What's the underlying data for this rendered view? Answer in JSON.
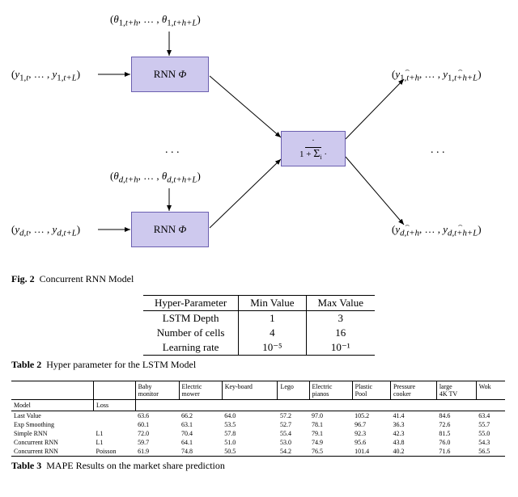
{
  "figure": {
    "theta_top": "(θ₁,ₜ₊ₕ, … , θ₁,ₜ₊ₕ₊L)",
    "theta_bot": "(θ_d,ₜ₊ₕ, … , θ_d,ₜ₊ₕ₊L)",
    "y_in_top": "(y₁,ₜ, … , y₁,ₜ₊L)",
    "y_in_bot": "(y_d,ₜ, … , y_d,ₜ₊L)",
    "rnn_label": "RNN Φ",
    "softmax_label": "· / (1 + Σᵢ ·)",
    "y_out_top": "(ŷ₁,ₜ₊ₕ, … , ŷ₁,ₜ₊ₕ₊L)",
    "y_out_bot": "(ŷ_d,ₜ₊ₕ, … , ŷ_d,ₜ₊ₕ₊L)",
    "dots": ". . .",
    "caption_num": "Fig. 2",
    "caption_text": "Concurrent RNN Model"
  },
  "hyper": {
    "caption_num": "Table 2",
    "caption_text": "Hyper parameter for the LSTM Model",
    "headers": [
      "Hyper-Parameter",
      "Min Value",
      "Max Value"
    ],
    "rows": [
      [
        "LSTM Depth",
        "1",
        "3"
      ],
      [
        "Number of cells",
        "4",
        "16"
      ],
      [
        "Learning rate",
        "10⁻⁵",
        "10⁻¹"
      ]
    ]
  },
  "mape": {
    "caption_num": "Table 3",
    "caption_text": "MAPE Results on the market share prediction",
    "col_model": "Model",
    "col_loss": "Loss",
    "columns": [
      "Baby monitor",
      "Electric mower",
      "Key-board",
      "Lego",
      "Electric pianos",
      "Plastic Pool",
      "Pressure cooker",
      "large 4K TV",
      "Wok"
    ],
    "rows": [
      {
        "model": "Last Value",
        "loss": "",
        "vals": [
          "63.6",
          "66.2",
          "64.0",
          "57.2",
          "97.0",
          "105.2",
          "41.4",
          "84.6",
          "63.4"
        ],
        "bold": []
      },
      {
        "model": "Exp Smoothing",
        "loss": "",
        "vals": [
          "60.1",
          "63.1",
          "53.5",
          "52.7",
          "78.1",
          "96.7",
          "36.3",
          "72.6",
          "55.7"
        ],
        "bold": [
          1,
          3,
          6
        ]
      },
      {
        "model": "Simple RNN",
        "loss": "L1",
        "vals": [
          "72.0",
          "70.4",
          "57.8",
          "55.4",
          "79.1",
          "92.3",
          "42.3",
          "81.5",
          "55.0"
        ],
        "bold": [
          5
        ]
      },
      {
        "model": "Concurrent RNN",
        "loss": "L1",
        "vals": [
          "59.7",
          "64.1",
          "51.0",
          "53.0",
          "74.9",
          "95.6",
          "43.8",
          "76.0",
          "54.3"
        ],
        "bold": [
          0,
          4,
          8
        ]
      },
      {
        "model": "Concurrent RNN",
        "loss": "Poisson",
        "vals": [
          "61.9",
          "74.8",
          "50.5",
          "54.2",
          "76.5",
          "101.4",
          "40.2",
          "71.6",
          "56.5"
        ],
        "bold": [
          2,
          7
        ]
      }
    ]
  },
  "chart_data": {
    "type": "diagram",
    "title": "Concurrent RNN Model",
    "nodes": [
      {
        "id": "rnn1",
        "label": "RNN Φ"
      },
      {
        "id": "rnn2",
        "label": "RNN Φ"
      },
      {
        "id": "norm",
        "label": "· / (1 + Σᵢ ·)"
      }
    ],
    "inputs": [
      {
        "to": "rnn1",
        "label": "(y₁,ₜ,…,y₁,ₜ₊L)"
      },
      {
        "to": "rnn1",
        "label": "(θ₁,ₜ₊ₕ,…,θ₁,ₜ₊ₕ₊L)"
      },
      {
        "to": "rnn2",
        "label": "(y_d,ₜ,…,y_d,ₜ₊L)"
      },
      {
        "to": "rnn2",
        "label": "(θ_d,ₜ₊ₕ,…,θ_d,ₜ₊ₕ₊L)"
      }
    ],
    "edges": [
      {
        "from": "rnn1",
        "to": "norm"
      },
      {
        "from": "rnn2",
        "to": "norm"
      }
    ],
    "outputs": [
      {
        "from": "norm",
        "label": "(ŷ₁,ₜ₊ₕ,…,ŷ₁,ₜ₊ₕ₊L)"
      },
      {
        "from": "norm",
        "label": "(ŷ_d,ₜ₊ₕ,…,ŷ_d,ₜ₊ₕ₊L)"
      }
    ]
  }
}
